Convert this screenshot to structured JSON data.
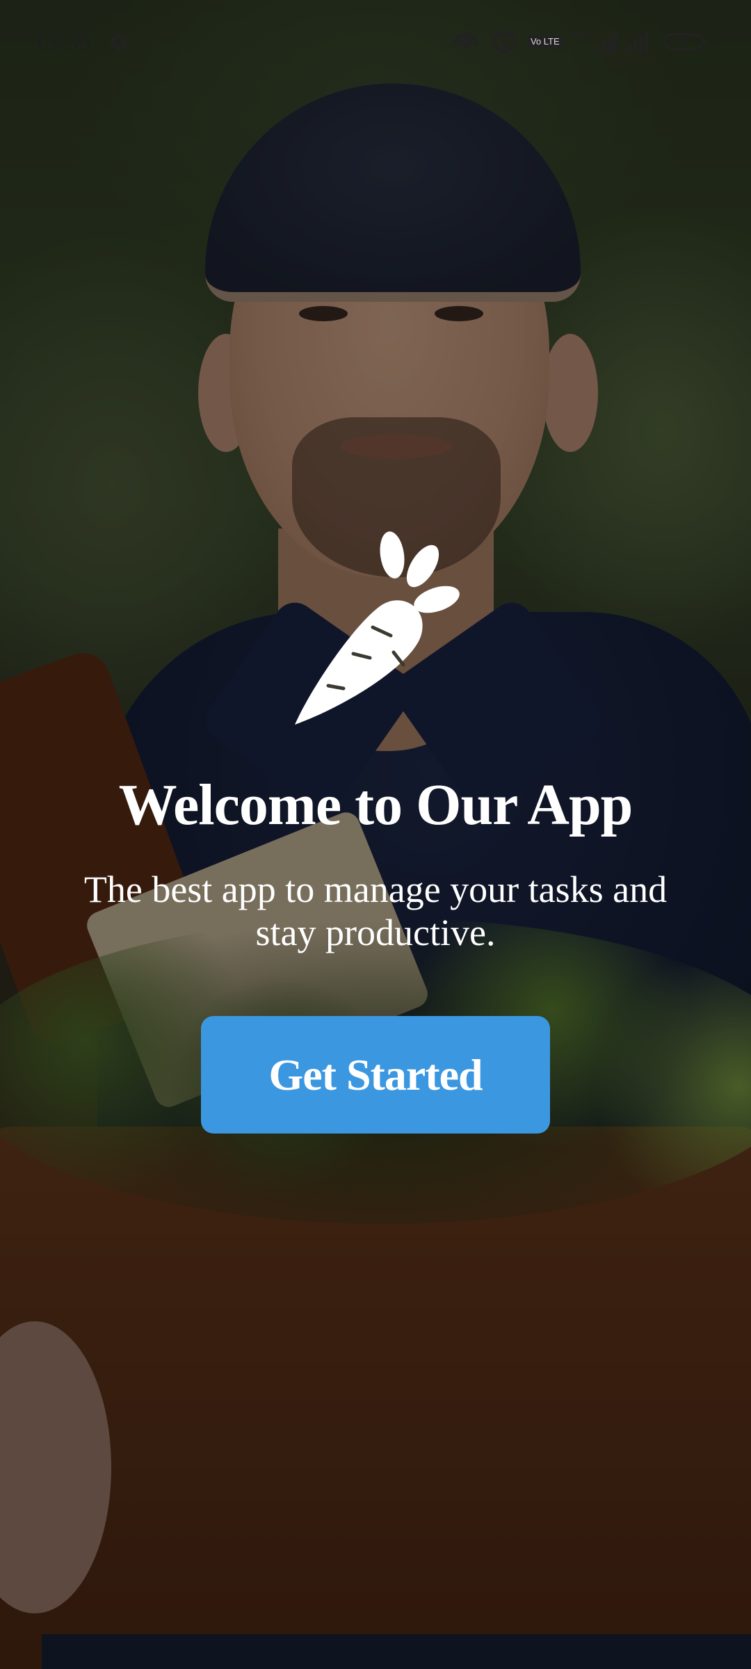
{
  "status_bar": {
    "time": "13:36",
    "network_label": "4G",
    "volte_label": "Vo LTE",
    "battery_level": "81"
  },
  "welcome": {
    "title": "Welcome to Our App",
    "subtitle": "The best app to manage your tasks and stay productive.",
    "cta_label": "Get Started"
  },
  "icons": {
    "settings": "gear-icon",
    "hotspot": "hotspot-icon",
    "location": "location-icon",
    "volte": "volte-icon",
    "signal": "signal-icon",
    "battery": "battery-icon",
    "logo": "carrot-icon"
  },
  "colors": {
    "cta_background": "#3b97e0",
    "text": "#ffffff",
    "overlay": "rgba(0,0,0,0.40)"
  }
}
